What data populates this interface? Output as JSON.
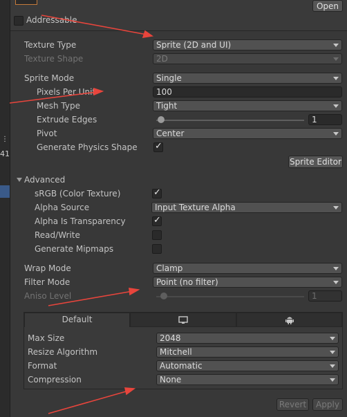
{
  "header": {
    "open_button": "Open",
    "addressable_label": "Addressable",
    "addressable_checked": false
  },
  "fields": {
    "texture_type": {
      "label": "Texture Type",
      "value": "Sprite (2D and UI)"
    },
    "texture_shape": {
      "label": "Texture Shape",
      "value": "2D"
    },
    "sprite_mode": {
      "label": "Sprite Mode",
      "value": "Single"
    },
    "pixels_per_unit": {
      "label": "Pixels Per Unit",
      "value": "100"
    },
    "mesh_type": {
      "label": "Mesh Type",
      "value": "Tight"
    },
    "extrude_edges": {
      "label": "Extrude Edges",
      "value": "1"
    },
    "pivot": {
      "label": "Pivot",
      "value": "Center"
    },
    "generate_physics_shape": {
      "label": "Generate Physics Shape",
      "checked": true
    },
    "sprite_editor_button": "Sprite Editor"
  },
  "advanced": {
    "header": "Advanced",
    "srgb": {
      "label": "sRGB (Color Texture)",
      "checked": true
    },
    "alpha_source": {
      "label": "Alpha Source",
      "value": "Input Texture Alpha"
    },
    "alpha_is_transparency": {
      "label": "Alpha Is Transparency",
      "checked": true
    },
    "read_write": {
      "label": "Read/Write",
      "checked": false
    },
    "generate_mipmaps": {
      "label": "Generate Mipmaps",
      "checked": false
    }
  },
  "wrap": {
    "wrap_mode": {
      "label": "Wrap Mode",
      "value": "Clamp"
    },
    "filter_mode": {
      "label": "Filter Mode",
      "value": "Point (no filter)"
    },
    "aniso_level": {
      "label": "Aniso Level",
      "value": "1"
    }
  },
  "platform": {
    "tabs": [
      {
        "label": "Default",
        "icon": ""
      },
      {
        "label": "",
        "icon": "monitor-icon"
      },
      {
        "label": "",
        "icon": "android-icon"
      }
    ],
    "max_size": {
      "label": "Max Size",
      "value": "2048"
    },
    "resize_algorithm": {
      "label": "Resize Algorithm",
      "value": "Mitchell"
    },
    "format": {
      "label": "Format",
      "value": "Automatic"
    },
    "compression": {
      "label": "Compression",
      "value": "None"
    }
  },
  "footer": {
    "revert": "Revert",
    "apply": "Apply"
  },
  "left_strip": {
    "number": "41"
  },
  "annotation_color": "#e8453c"
}
